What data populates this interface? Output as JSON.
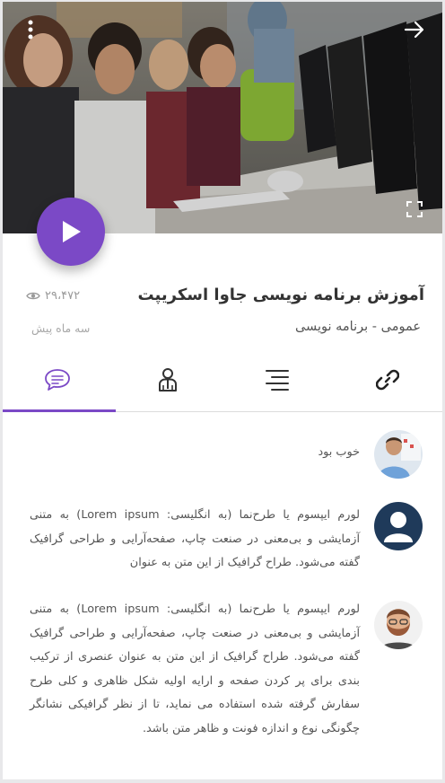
{
  "video": {
    "more_icon": "more-vertical-icon",
    "back_icon": "arrow-right-icon",
    "fullscreen_icon": "fullscreen-icon",
    "play_icon": "play-icon"
  },
  "course": {
    "title": "آموزش برنامه نویسی جاوا اسکریپت",
    "category": "عمومی - برنامه نویسی",
    "views": "۲۹،۴۷۲",
    "date": "سه ماه پیش"
  },
  "tabs": [
    {
      "name": "links",
      "icon": "link-icon"
    },
    {
      "name": "chapters",
      "icon": "list-icon"
    },
    {
      "name": "instructor",
      "icon": "user-icon"
    },
    {
      "name": "comments",
      "icon": "comment-icon",
      "active": true
    }
  ],
  "comments": [
    {
      "avatar": "avatar-presenter",
      "text": "خوب بود"
    },
    {
      "avatar": "avatar-placeholder",
      "text": "لورم ایپسوم یا طرح‌نما (به انگلیسی: Lorem ipsum) به متنی آزمایشی و بی‌معنی در صنعت چاپ، صفحه‌آرایی و طراحی گرافیک گفته می‌شود. طراح گرافیک از این متن به عنوان"
    },
    {
      "avatar": "avatar-bearded",
      "text": "لورم ایپسوم یا طرح‌نما (به انگلیسی: Lorem ipsum) به متنی آزمایشی و بی‌معنی در صنعت چاپ، صفحه‌آرایی و طراحی گرافیک گفته می‌شود. طراح گرافیک از این متن به عنوان عنصری از ترکیب بندی برای پر کردن صفحه و ارایه اولیه شکل ظاهری و کلی طرح سفارش گرفته شده استفاده می نماید، تا از نظر گرافیکی نشانگر چگونگی نوع و اندازه فونت و ظاهر متن باشد."
    }
  ],
  "colors": {
    "accent": "#7b49c6",
    "avatar_placeholder": "#1f3a5a"
  }
}
